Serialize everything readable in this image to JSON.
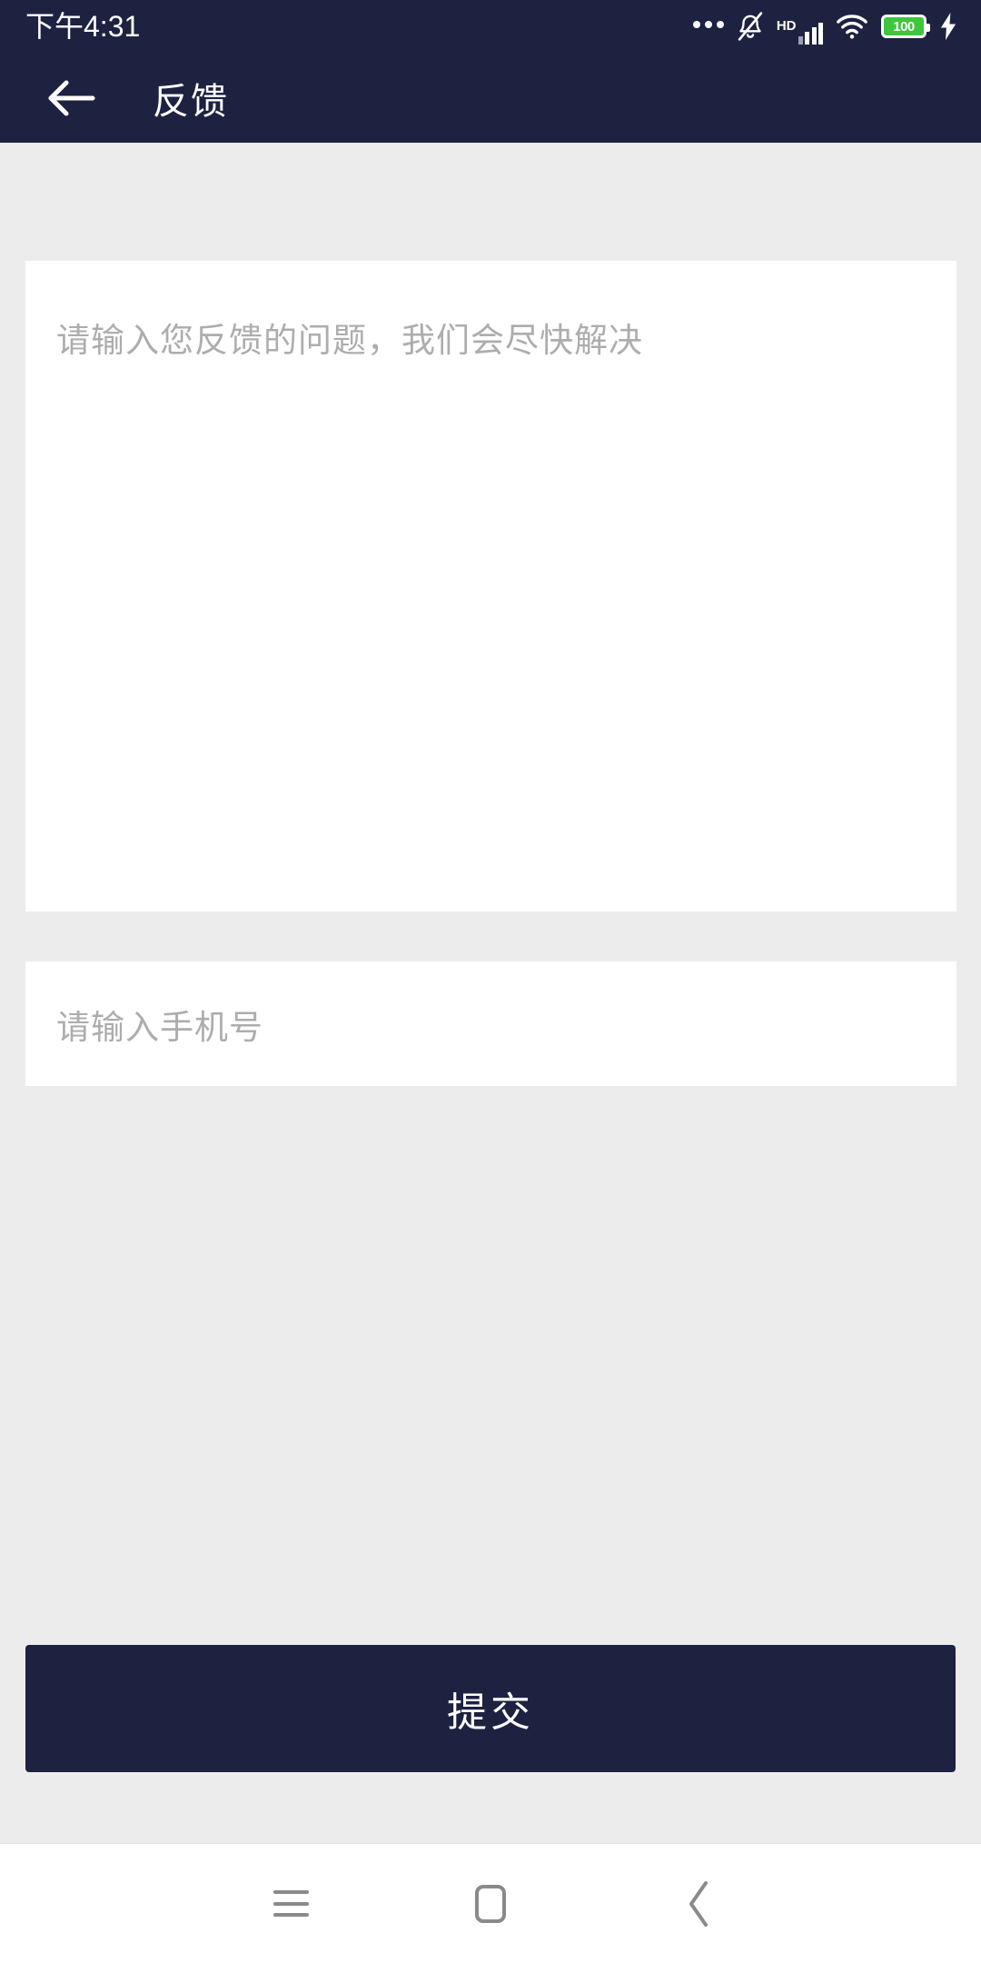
{
  "status_bar": {
    "time": "下午4:31",
    "battery_level": "100",
    "hd_label": "HD",
    "icons": [
      "more-dots-icon",
      "bell-muted-icon",
      "hd-icon",
      "signal-bars-icon",
      "wifi-icon",
      "battery-icon",
      "charging-bolt-icon"
    ]
  },
  "header": {
    "title": "反馈",
    "back_icon": "arrow-left-icon",
    "background_color": "#1d2240"
  },
  "main": {
    "feedback_field": {
      "placeholder": "请输入您反馈的问题，我们会尽快解决",
      "value": ""
    },
    "phone_field": {
      "placeholder": "请输入手机号",
      "value": ""
    },
    "submit_button": {
      "label": "提交",
      "color": "#1d2240"
    },
    "background_color": "#ececec"
  },
  "nav_bar": {
    "items": [
      {
        "name": "menu-icon"
      },
      {
        "name": "home-icon"
      },
      {
        "name": "back-icon"
      }
    ]
  }
}
